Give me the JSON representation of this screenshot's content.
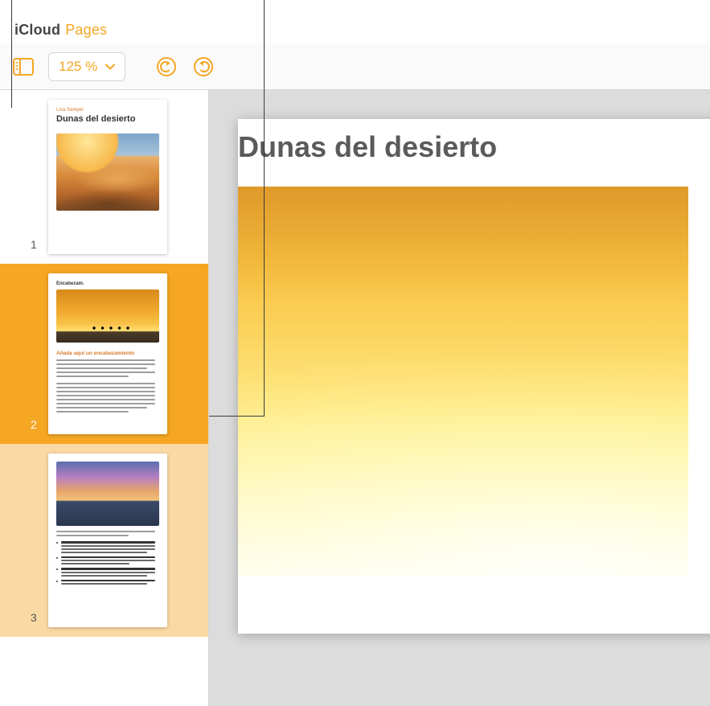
{
  "header": {
    "brand_left": "iCloud",
    "brand_right": "Pages"
  },
  "toolbar": {
    "zoom_label": "125 %"
  },
  "sidebar": {
    "thumbs": [
      {
        "page_num": "1",
        "selected": false,
        "section": 1,
        "superhead": "Lina Semper",
        "heading": "Dunas del desierto"
      },
      {
        "page_num": "2",
        "selected": true,
        "section": 1,
        "superhead": "Encabezam.",
        "subheading": "Añada aquí un encabezamiento"
      },
      {
        "page_num": "3",
        "selected": false,
        "section": 2
      }
    ]
  },
  "main": {
    "title": "Dunas del desierto"
  },
  "colors": {
    "accent": "#f5a623"
  }
}
